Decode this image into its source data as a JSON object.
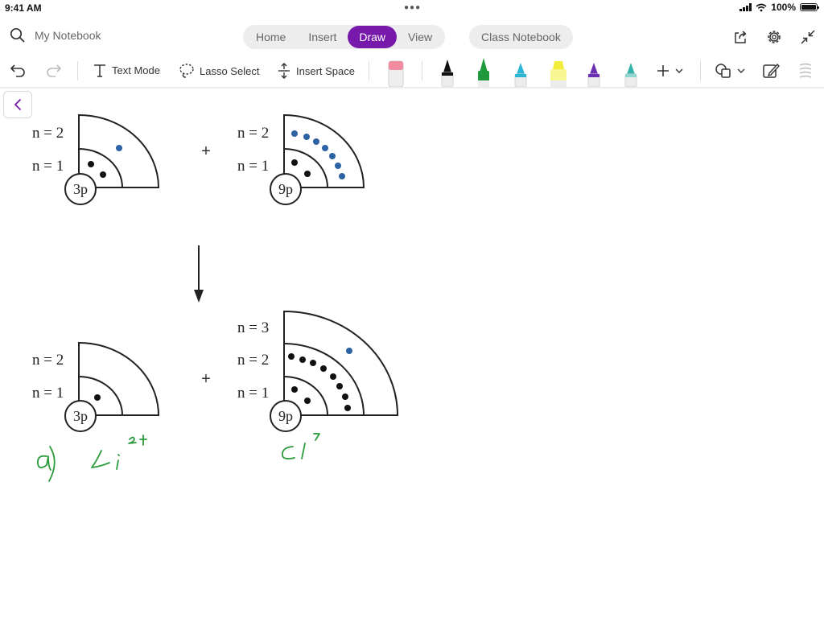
{
  "status": {
    "time": "9:41 AM",
    "battery": "100%"
  },
  "header": {
    "search_placeholder": "My Notebook",
    "tabs": [
      {
        "label": "Home",
        "active": false
      },
      {
        "label": "Insert",
        "active": false
      },
      {
        "label": "Draw",
        "active": true
      },
      {
        "label": "View",
        "active": false
      }
    ],
    "class_notebook": "Class Notebook",
    "icons": [
      "share-icon",
      "gear-icon",
      "collapse-icon"
    ]
  },
  "toolbar": {
    "text_mode": "Text Mode",
    "lasso_select": "Lasso Select",
    "insert_space": "Insert Space",
    "pens": [
      {
        "name": "eraser",
        "color": "#f28ba0"
      },
      {
        "name": "black-pen",
        "color": "#111111"
      },
      {
        "name": "green-pen",
        "color": "#1e9a3c"
      },
      {
        "name": "cyan-pen",
        "color": "#2db6d4"
      },
      {
        "name": "yellow-highlighter",
        "color": "#f3ee3a"
      },
      {
        "name": "purple-pen",
        "color": "#6a2eb0"
      },
      {
        "name": "teal-pen",
        "color": "#3ab3ad"
      }
    ],
    "accent": "#7719aa"
  },
  "diagram": {
    "labels": {
      "n1": "n = 1",
      "n2": "n = 2",
      "n3": "n = 3",
      "plus": "+",
      "li_nucleus": "3p",
      "cl_nucleus": "9p"
    },
    "electron_colors": {
      "core": "#111111",
      "valence": "#2d62a3"
    }
  },
  "handwriting": {
    "part": "a)",
    "li": "Li",
    "li_charge": "2+",
    "cl": "Cl",
    "cl_charge": "-"
  }
}
